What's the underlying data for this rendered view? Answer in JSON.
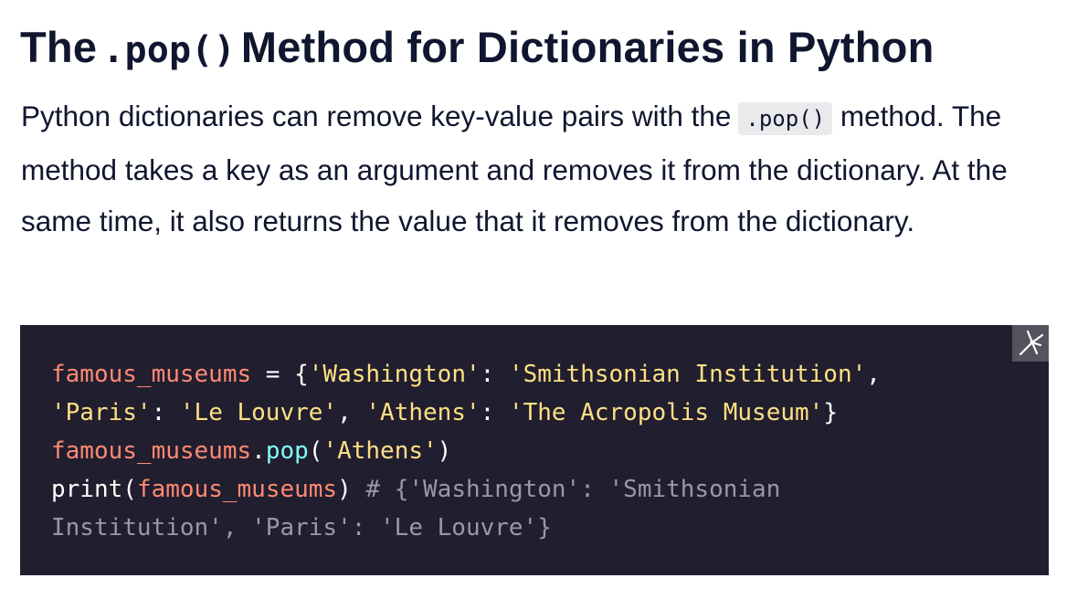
{
  "heading": {
    "before": "The",
    "code": ".pop()",
    "after": "Method for Dictionaries in Python"
  },
  "paragraph": {
    "text_before": "Python dictionaries can remove key-value pairs with the",
    "inline_code": ".pop()",
    "text_after": "method. The method takes a key as an argument and removes it from the dictionary. At the same time, it also returns the value that it removes from the dictionary."
  },
  "code": {
    "line1": {
      "var": "famous_museums",
      "op": " = ",
      "p1": "{",
      "s1": "'Washington'",
      "p2": ": ",
      "s2": "'Smithsonian Institution'",
      "p3": ","
    },
    "line2": {
      "s1": "'Paris'",
      "p1": ": ",
      "s2": "'Le Louvre'",
      "p2": ", ",
      "s3": "'Athens'",
      "p3": ": ",
      "s4": "'The Acropolis Museum'",
      "p4": "}"
    },
    "line3": {
      "var": "famous_museums",
      "p1": ".",
      "fn": "pop",
      "p2": "(",
      "s1": "'Athens'",
      "p3": ")"
    },
    "line4": {
      "fn": "print",
      "p1": "(",
      "var": "famous_museums",
      "p2": ") ",
      "comment": "# {'Washington': 'Smithsonian"
    },
    "line5": {
      "comment": "Institution', 'Paris': 'Le Louvre'}"
    }
  },
  "icons": {
    "code_block_corner": "expand-icon"
  },
  "colors": {
    "heading_text": "#10162f",
    "code_background": "#211e2f",
    "variable": "#ff8973",
    "string": "#ffe083",
    "function": "#83fff5",
    "comment": "#9a98a6",
    "inline_code_background": "#eaeaec"
  }
}
